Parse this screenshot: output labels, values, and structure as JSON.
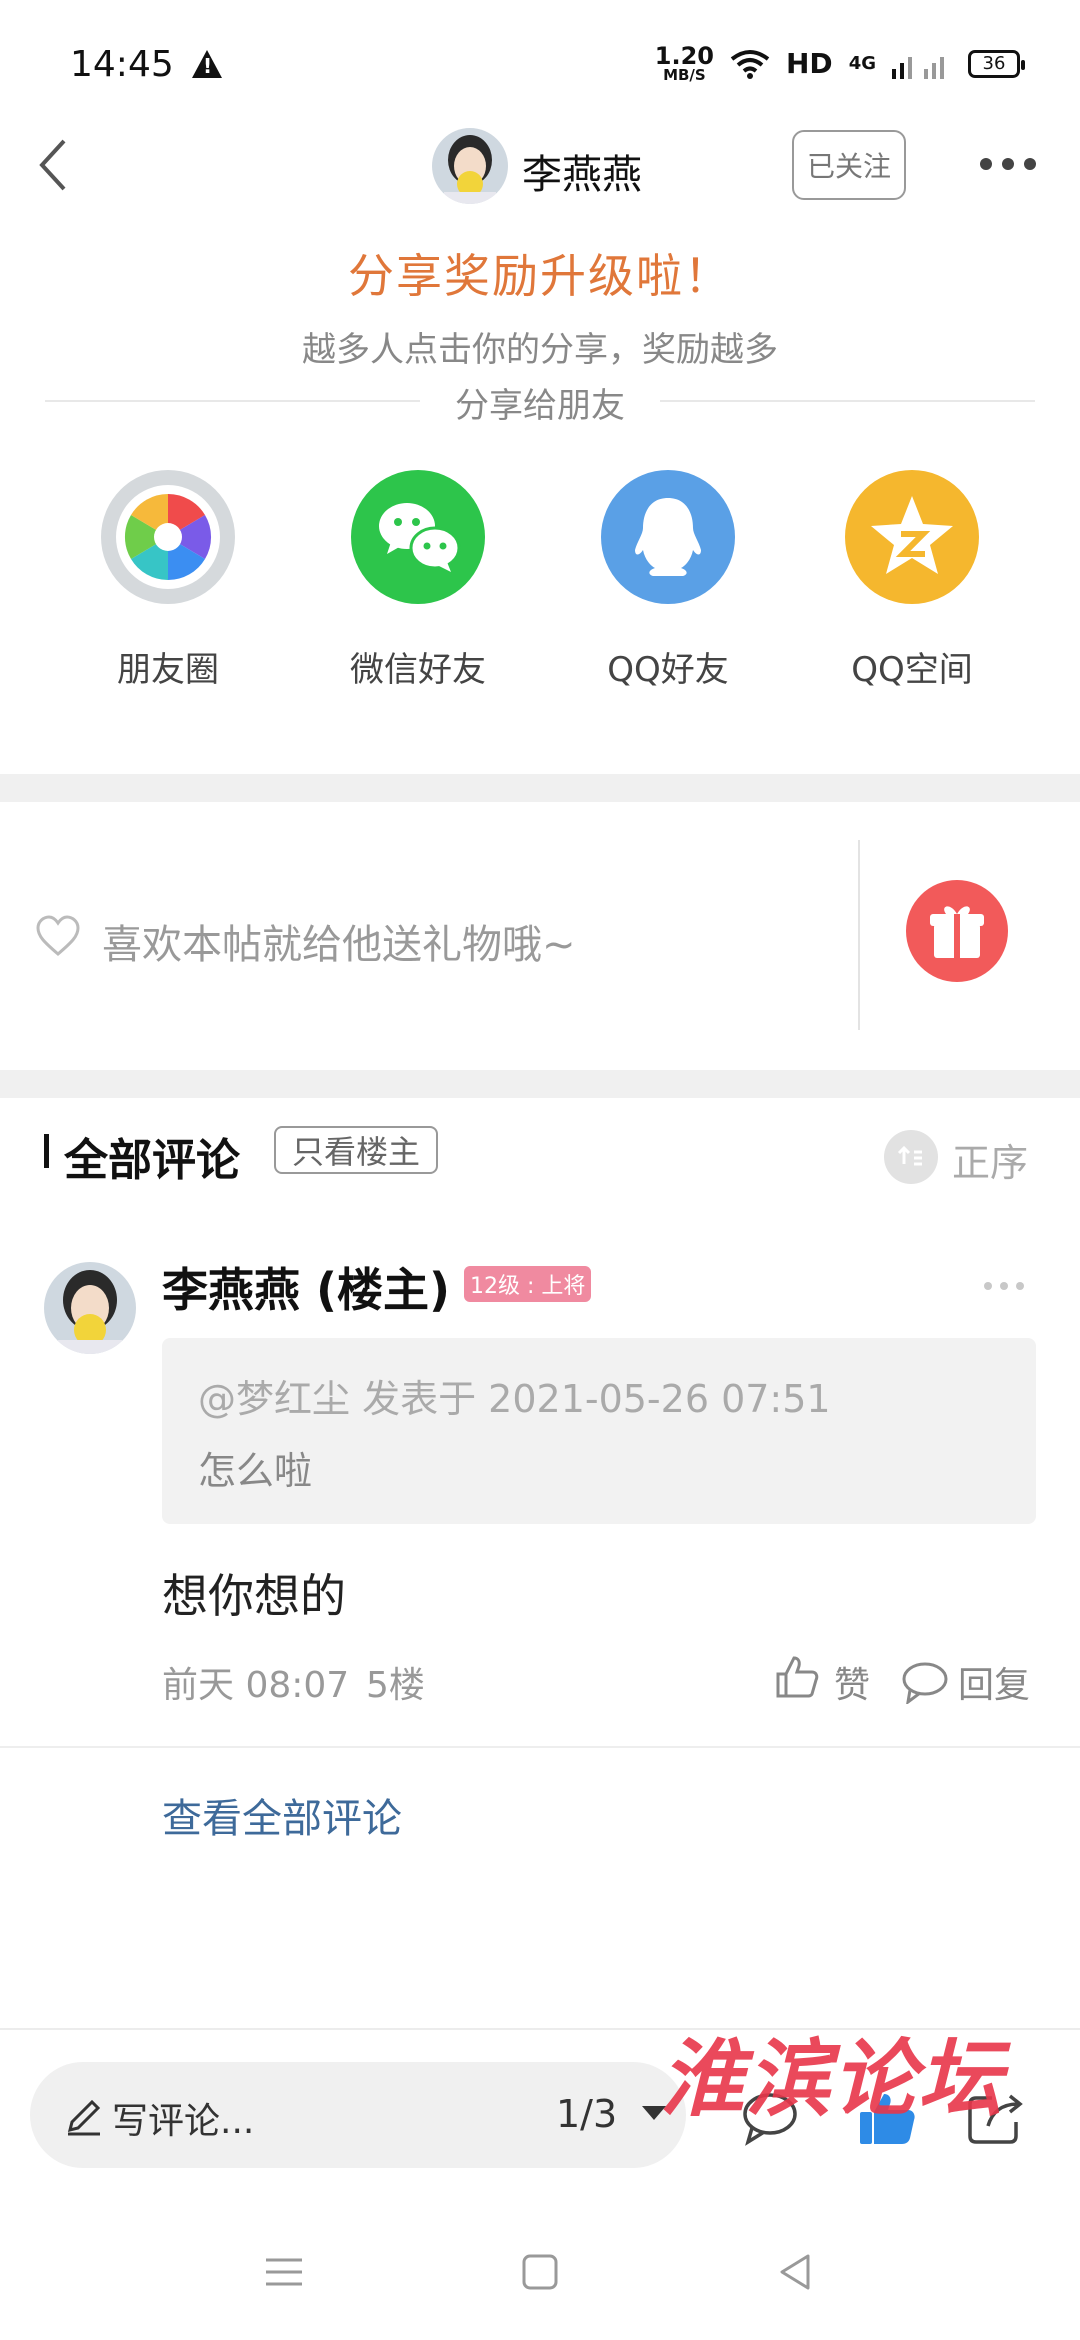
{
  "status_bar": {
    "time": "14:45",
    "net_speed_value": "1.20",
    "net_speed_unit": "MB/S",
    "hd_label": "HD",
    "signal_label": "4G",
    "battery": "36"
  },
  "header": {
    "owner_name": "李燕燕",
    "follow_label": "已关注"
  },
  "share": {
    "title": "分享奖励升级啦！",
    "subtitle": "越多人点击你的分享，奖励越多",
    "share_to": "分享给朋友",
    "items": [
      {
        "label": "朋友圈",
        "icon": "moments-icon"
      },
      {
        "label": "微信好友",
        "icon": "wechat-icon"
      },
      {
        "label": "QQ好友",
        "icon": "qq-icon"
      },
      {
        "label": "QQ空间",
        "icon": "qzone-icon"
      }
    ]
  },
  "gift": {
    "prompt": "喜欢本帖就给他送礼物哦~"
  },
  "comments": {
    "title": "全部评论",
    "only_owner": "只看楼主",
    "sort_label": "正序",
    "items": [
      {
        "name": "李燕燕 (楼主)",
        "badge": "12级 : 上将",
        "quote_meta": "@梦红尘 发表于 2021-05-26 07:51",
        "quote_text": "怎么啦",
        "body": "想你想的",
        "time": "前天 08:07",
        "floor": "5楼",
        "like_label": "赞",
        "reply_label": "回复"
      }
    ],
    "view_all": "查看全部评论"
  },
  "bottom_bar": {
    "write_label": "写评论...",
    "page_indicator": "1/3",
    "watermark": "淮滨论坛"
  },
  "colors": {
    "accent_orange": "#e0773a",
    "gift_red": "#f25a5a",
    "link_blue": "#3e6a9a",
    "thumb_blue": "#2e8be6"
  }
}
